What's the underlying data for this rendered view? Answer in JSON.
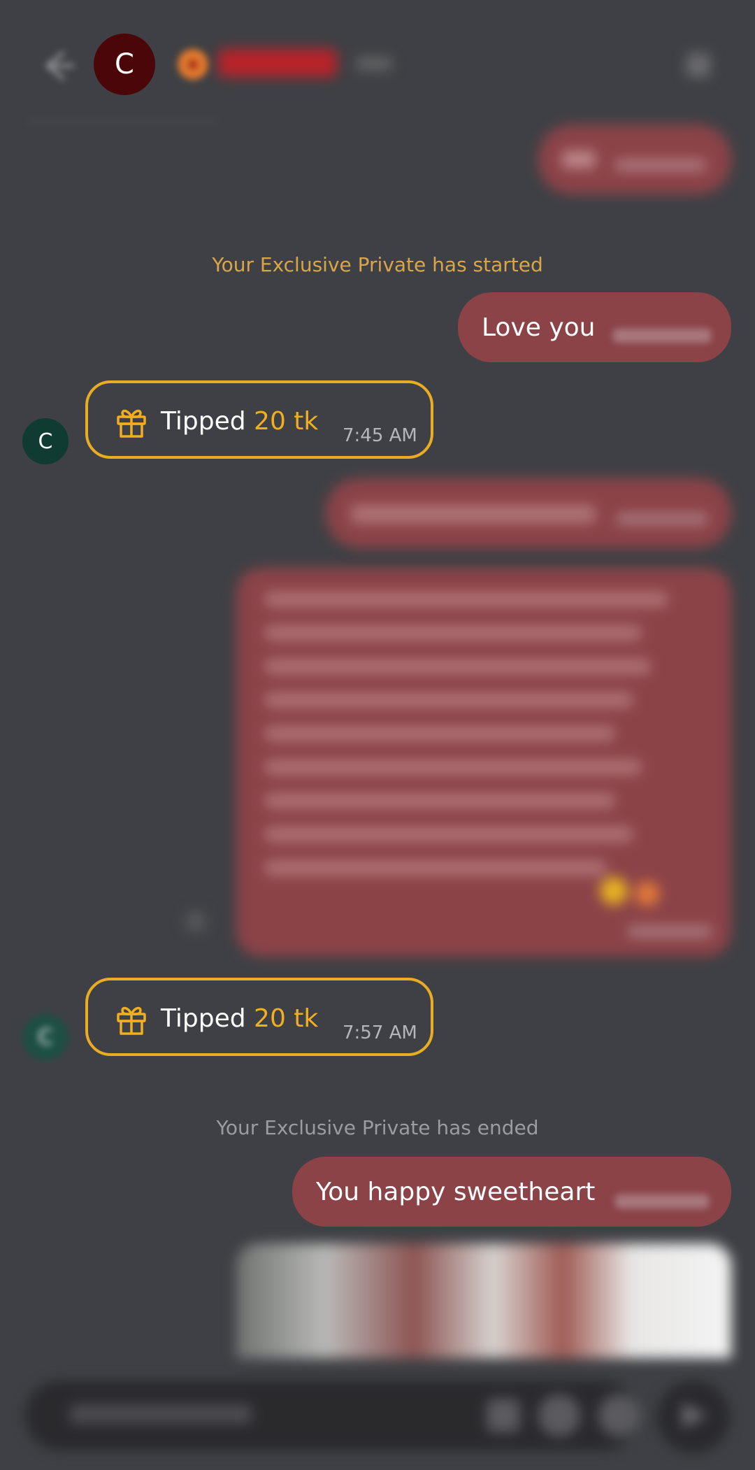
{
  "header": {
    "avatar_initial": "C"
  },
  "messages": {
    "exclusive_started": "Your Exclusive Private has started",
    "love_you": "Love you",
    "tip1": {
      "verb": "Tipped",
      "amount": "20 tk",
      "time": "7:45 AM",
      "avatar_initial": "C"
    },
    "tip2": {
      "verb": "Tipped",
      "amount": "20 tk",
      "time": "7:57 AM",
      "avatar_initial": "C"
    },
    "exclusive_ended": "Your Exclusive Private has ended",
    "you_happy": "You happy sweetheart"
  },
  "colors": {
    "background": "#3f4045",
    "outgoing_bubble": "#8b4348",
    "tip_accent": "#e9ad23",
    "started_text": "#d8a64a"
  }
}
